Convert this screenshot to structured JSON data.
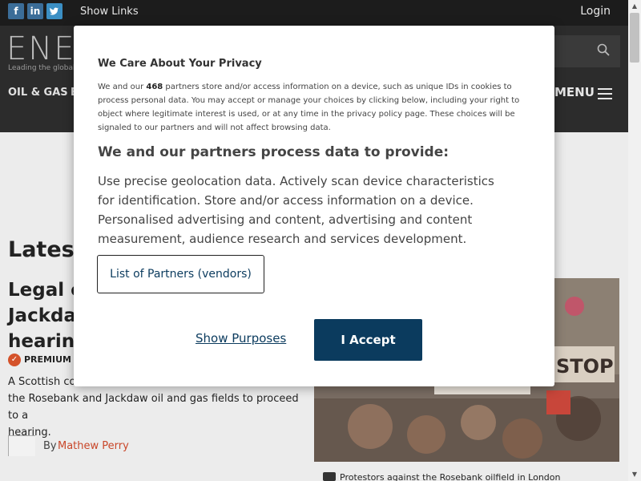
{
  "topbar": {
    "social": [
      {
        "icon": "facebook-icon",
        "glyph": "f",
        "color": "#3b6d98"
      },
      {
        "icon": "linkedin-icon",
        "glyph": "in",
        "color": "#3b6d98"
      },
      {
        "icon": "twitter-icon",
        "glyph": "t",
        "color": "#3b8fc4"
      }
    ],
    "show_links": "Show Links",
    "login": "Login"
  },
  "header": {
    "logo": "ENER",
    "tagline": "Leading the global e",
    "nav": [
      "OIL & GAS",
      "E"
    ],
    "menu": "MENU"
  },
  "content": {
    "latest": "Latest",
    "headline_lines": [
      "Legal ch",
      "Jackdaw",
      "hearing"
    ],
    "premium": "PREMIUM C",
    "summary": "A Scottish cou  to proceed to a hearing.",
    "summary_line1": "A Scottish cou",
    "summary_line2": "the Rosebank and Jackdaw oil and gas fields to proceed to a",
    "summary_line3": "hearing.",
    "by": "By",
    "author": "Mathew Perry",
    "caption": "Protestors against the Rosebank oilfield in London"
  },
  "consent": {
    "title": "We Care About Your Privacy",
    "body_prefix": "We and our ",
    "partner_count": "468",
    "body_suffix": " partners store and/or access information on a device, such as unique IDs in cookies to process personal data. You may accept or manage your choices by clicking below, including your right to object where legitimate interest is used, or at any time in the privacy policy page. These choices will be signaled to our partners and will not affect browsing data.",
    "subtitle": "We and our partners process data to provide:",
    "purposes": "Use precise geolocation data. Actively scan device characteristics for identification. Store and/or access information on a device. Personalised advertising and content, advertising and content measurement, audience research and services development.",
    "partners_button": "List of Partners (vendors)",
    "show_purposes": "Show Purposes",
    "accept": "I Accept"
  },
  "colors": {
    "accept_bg": "#0b3b5e",
    "link": "#0b3b5e",
    "author_link": "#c9472a",
    "premium_badge": "#d4522a"
  }
}
